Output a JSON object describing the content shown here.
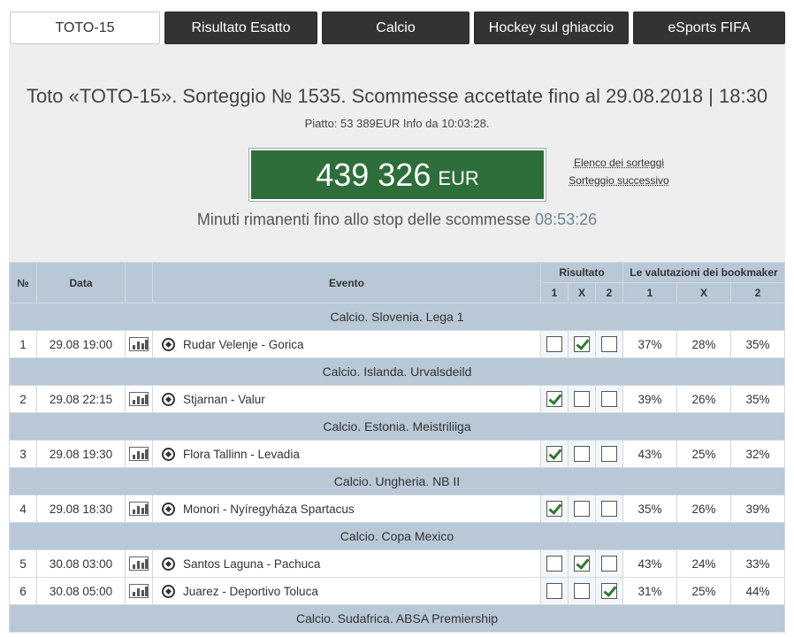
{
  "tabs": [
    {
      "label": "TOTO-15",
      "active": true
    },
    {
      "label": "Risultato Esatto",
      "active": false
    },
    {
      "label": "Calcio",
      "active": false
    },
    {
      "label": "Hockey sul ghiaccio",
      "active": false
    },
    {
      "label": "eSports FIFA",
      "active": false
    }
  ],
  "header": {
    "title": "Toto «TOTO-15». Sorteggio № 1535. Scommesse accettate fino al 29.08.2018 | 18:30",
    "subtitle": "Piatto: 53 389EUR Info da 10:03:28."
  },
  "jackpot": {
    "amount": "439 326",
    "currency": "EUR",
    "color": "#2e6e3a"
  },
  "links": {
    "draws_list": "Elenco dei sorteggi",
    "next_draw": "Sorteggio successivo"
  },
  "countdown": {
    "label": "Minuti rimanenti fino allo stop delle scommesse",
    "time": "08:53:26"
  },
  "table": {
    "headers": {
      "num": "№",
      "date": "Data",
      "event": "Evento",
      "result": "Risultato",
      "bookmakers": "Le valutazioni dei bookmaker",
      "one": "1",
      "x": "X",
      "two": "2"
    },
    "groups": [
      {
        "league": "Calcio. Slovenia. Lega 1",
        "matches": [
          {
            "n": "1",
            "date": "29.08 19:00",
            "event": "Rudar Velenje - Gorica",
            "pick": "X",
            "p1": "37%",
            "px": "28%",
            "p2": "35%"
          }
        ]
      },
      {
        "league": "Calcio. Islanda. Urvalsdeild",
        "matches": [
          {
            "n": "2",
            "date": "29.08 22:15",
            "event": "Stjarnan - Valur",
            "pick": "1",
            "p1": "39%",
            "px": "26%",
            "p2": "35%"
          }
        ]
      },
      {
        "league": "Calcio. Estonia. Meistriliiga",
        "matches": [
          {
            "n": "3",
            "date": "29.08 19:30",
            "event": "Flora Tallinn - Levadia",
            "pick": "1",
            "p1": "43%",
            "px": "25%",
            "p2": "32%"
          }
        ]
      },
      {
        "league": "Calcio. Ungheria. NB II",
        "matches": [
          {
            "n": "4",
            "date": "29.08 18:30",
            "event": "Monori - Nyíregyháza Spartacus",
            "pick": "1",
            "p1": "35%",
            "px": "26%",
            "p2": "39%"
          }
        ]
      },
      {
        "league": "Calcio. Copa Mexico",
        "matches": [
          {
            "n": "5",
            "date": "30.08 03:00",
            "event": "Santos Laguna - Pachuca",
            "pick": "X",
            "p1": "43%",
            "px": "24%",
            "p2": "33%"
          },
          {
            "n": "6",
            "date": "30.08 05:00",
            "event": "Juarez - Deportivo Toluca",
            "pick": "2",
            "p1": "31%",
            "px": "25%",
            "p2": "44%"
          }
        ]
      },
      {
        "league": "Calcio. Sudafrica. ABSA Premiership",
        "matches": []
      }
    ]
  }
}
